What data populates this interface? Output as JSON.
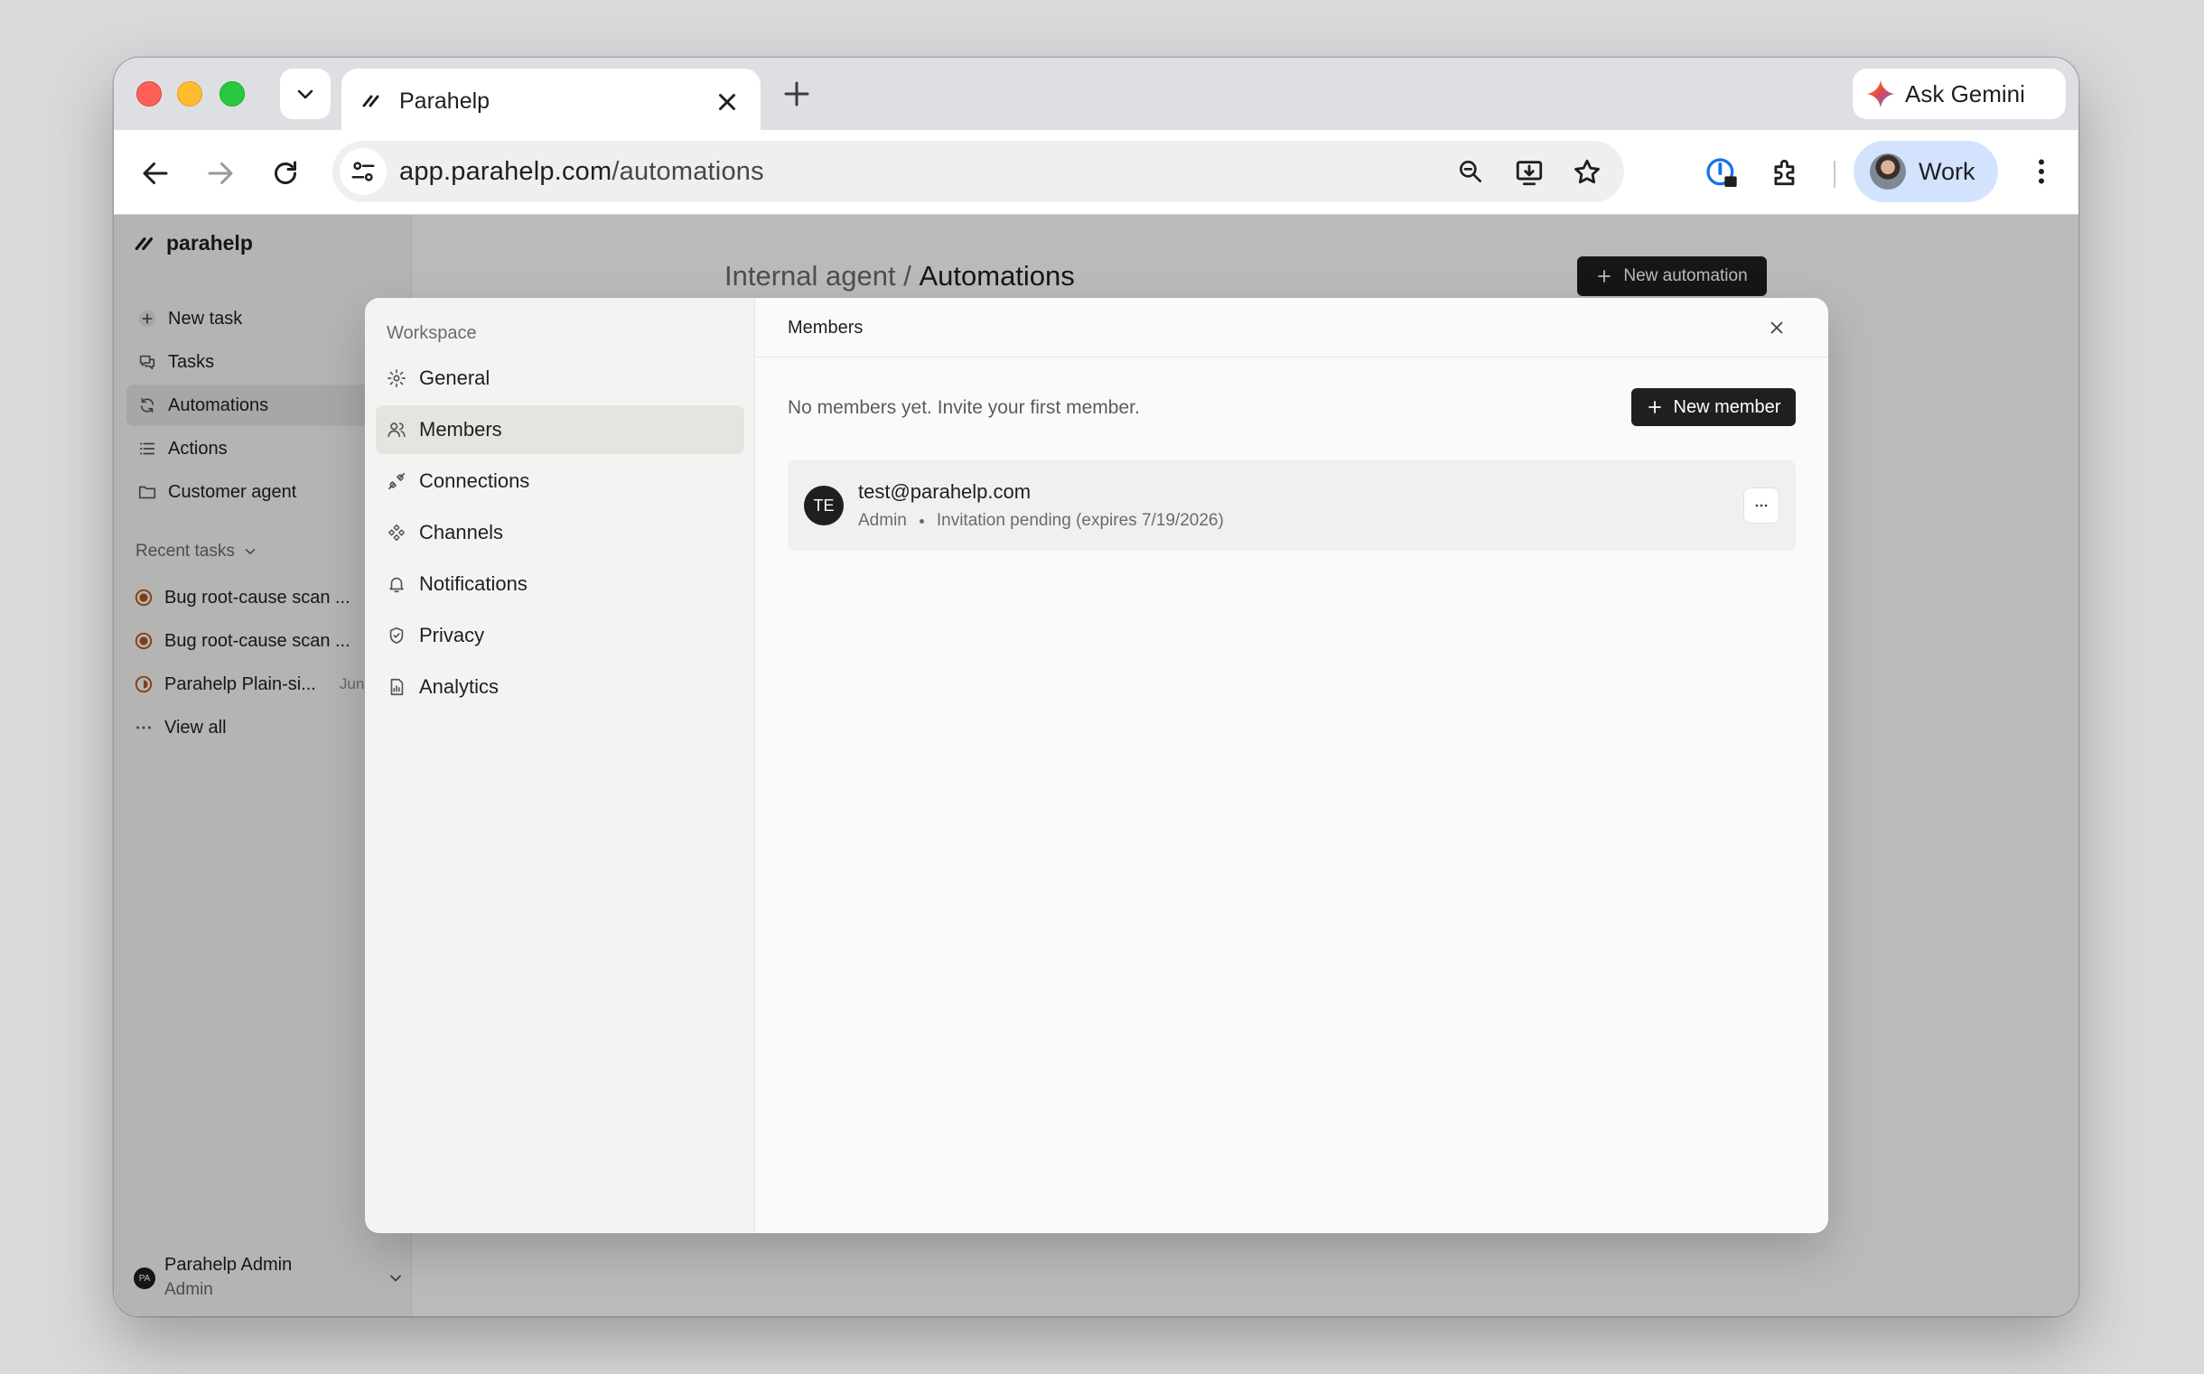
{
  "browser": {
    "tab_title": "Parahelp",
    "gemini_label": "Ask Gemini",
    "url_host": "app.parahelp.com",
    "url_path": "/automations",
    "profile_label": "Work"
  },
  "sidebar": {
    "brand": "parahelp",
    "items": [
      {
        "label": "New task",
        "icon": "plus-icon"
      },
      {
        "label": "Tasks",
        "icon": "chat-icon"
      },
      {
        "label": "Automations",
        "icon": "refresh-icon"
      },
      {
        "label": "Actions",
        "icon": "list-icon"
      },
      {
        "label": "Customer agent",
        "icon": "folder-icon"
      }
    ],
    "recent_heading": "Recent tasks",
    "recent": [
      {
        "label": "Bug root-cause scan ...",
        "date": ""
      },
      {
        "label": "Bug root-cause scan ...",
        "date": ""
      },
      {
        "label": "Parahelp Plain-si...",
        "date": "Jun"
      }
    ],
    "view_all": "View all",
    "user": {
      "initials": "PA",
      "name": "Parahelp Admin",
      "role": "Admin"
    }
  },
  "main": {
    "breadcrumb_parent": "Internal agent",
    "breadcrumb_sep": "/",
    "breadcrumb_current": "Automations",
    "new_automation_label": "New automation"
  },
  "modal": {
    "nav_heading": "Workspace",
    "nav": [
      {
        "label": "General",
        "icon": "gear-icon"
      },
      {
        "label": "Members",
        "icon": "users-icon"
      },
      {
        "label": "Connections",
        "icon": "plug-icon"
      },
      {
        "label": "Channels",
        "icon": "channels-icon"
      },
      {
        "label": "Notifications",
        "icon": "bell-icon"
      },
      {
        "label": "Privacy",
        "icon": "shield-icon"
      },
      {
        "label": "Analytics",
        "icon": "chart-icon"
      }
    ],
    "active_nav": "Members",
    "title": "Members",
    "empty_text": "No members yet. Invite your first member.",
    "new_member_label": "New member",
    "member": {
      "initials": "TE",
      "email": "test@parahelp.com",
      "role": "Admin",
      "status": "Invitation pending (expires 7/19/2026)"
    }
  }
}
